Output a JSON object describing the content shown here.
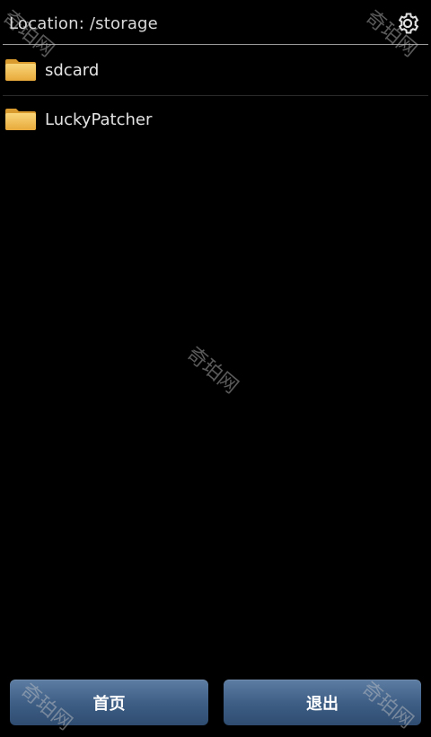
{
  "header": {
    "location_text": "Location: /storage",
    "settings_icon": "gear-icon"
  },
  "files": [
    {
      "name": "sdcard",
      "icon": "folder-icon"
    },
    {
      "name": "LuckyPatcher",
      "icon": "folder-icon"
    }
  ],
  "footer": {
    "home_label": "首页",
    "exit_label": "退出"
  },
  "watermark": {
    "text": "奇珀网"
  },
  "colors": {
    "background": "#000000",
    "button_top": "#5d7da3",
    "button_bottom": "#2f4c70",
    "folder": "#f4c156"
  }
}
